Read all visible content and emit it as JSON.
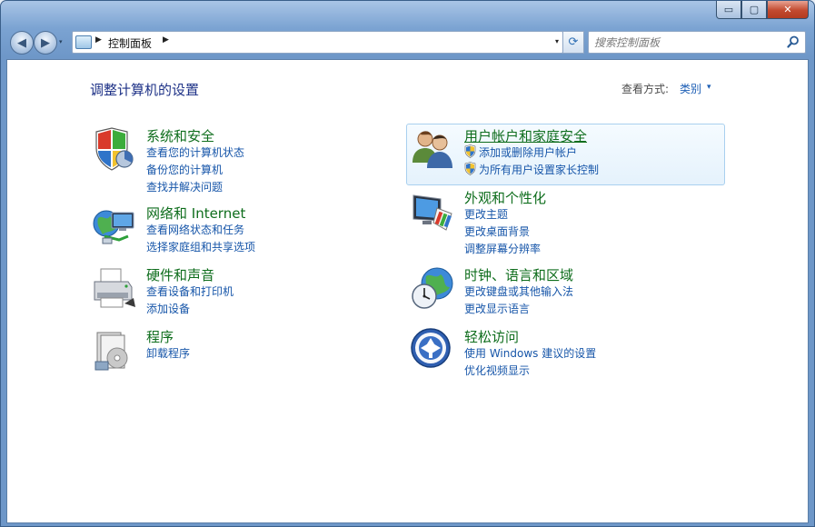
{
  "window": {
    "caption_buttons": {
      "minimize": "▭",
      "maximize": "▢",
      "close": "✕"
    }
  },
  "toolbar": {
    "back_icon": "◀",
    "forward_icon": "▶",
    "history_drop": "▾",
    "address": {
      "breadcrumb_sep": "▶",
      "location": "控制面板",
      "dropdown": "▾"
    },
    "refresh_icon": "⟳",
    "search": {
      "placeholder": "搜索控制面板"
    }
  },
  "main": {
    "title": "调整计算机的设置",
    "view_by": {
      "label": "查看方式:",
      "value": "类别",
      "dropdown": "▾"
    }
  },
  "categories": [
    {
      "title": "系统和安全",
      "links": [
        "查看您的计算机状态",
        "备份您的计算机",
        "查找并解决问题"
      ],
      "icon": "shield-icon"
    },
    {
      "title": "网络和 Internet",
      "links": [
        "查看网络状态和任务",
        "选择家庭组和共享选项"
      ],
      "icon": "network-icon"
    },
    {
      "title": "硬件和声音",
      "links": [
        "查看设备和打印机",
        "添加设备"
      ],
      "icon": "printer-icon"
    },
    {
      "title": "程序",
      "links": [
        "卸载程序"
      ],
      "icon": "programs-icon"
    },
    {
      "title": "用户帐户和家庭安全",
      "links": [
        "添加或删除用户帐户",
        "为所有用户设置家长控制"
      ],
      "icon": "users-icon"
    },
    {
      "title": "外观和个性化",
      "links": [
        "更改主题",
        "更改桌面背景",
        "调整屏幕分辨率"
      ],
      "icon": "monitor-icon"
    },
    {
      "title": "时钟、语言和区域",
      "links": [
        "更改键盘或其他输入法",
        "更改显示语言"
      ],
      "icon": "clock-globe-icon"
    },
    {
      "title": "轻松访问",
      "links": [
        "使用 Windows 建议的设置",
        "优化视频显示"
      ],
      "icon": "ease-of-access-icon"
    }
  ],
  "colors": {
    "category_title": "#0e6d1c",
    "link": "#1756a9",
    "page_title": "#1e3287",
    "highlight_border": "#a9d0ef"
  }
}
